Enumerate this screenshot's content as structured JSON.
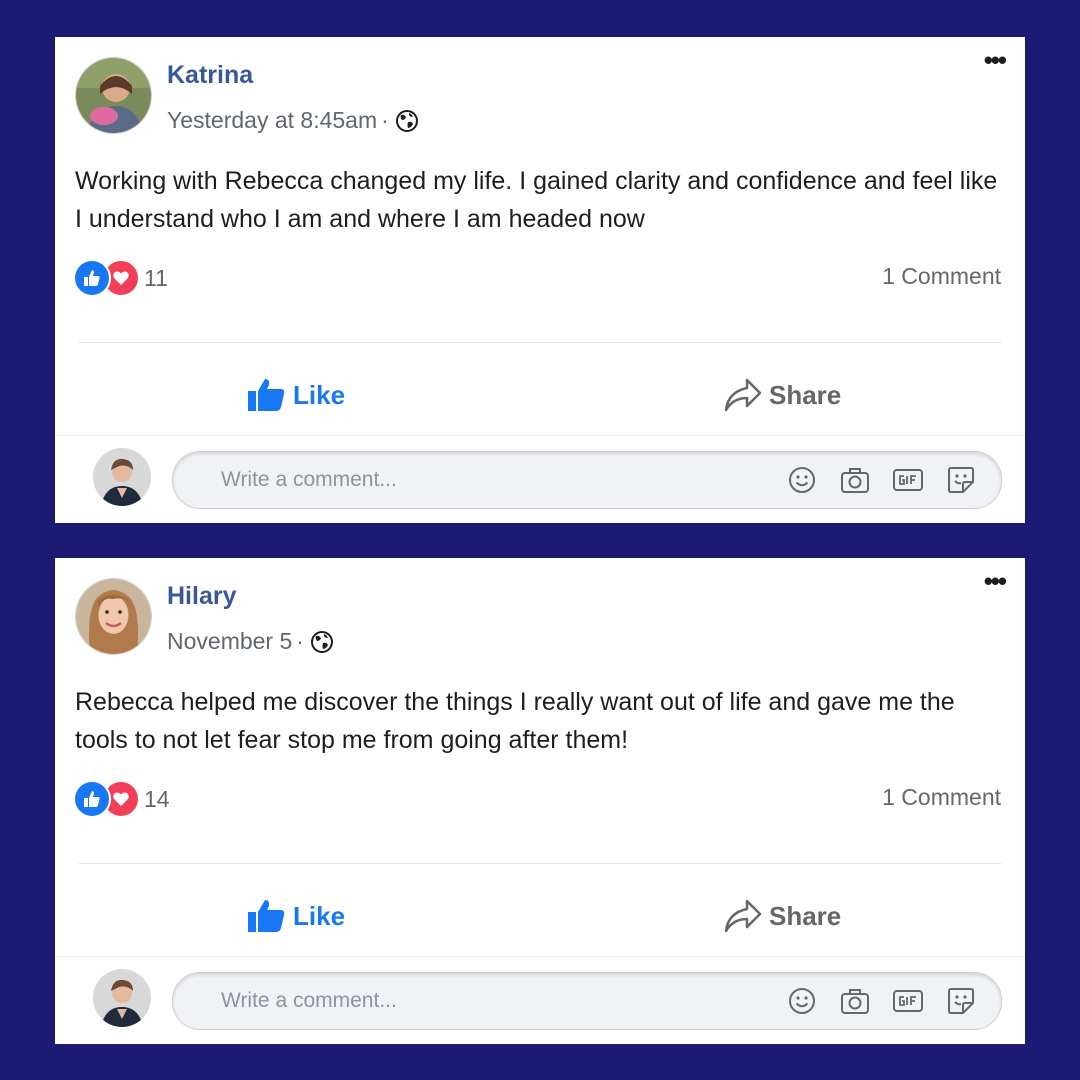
{
  "posts": [
    {
      "author": "Katrina",
      "timestamp": "Yesterday at 8:45am",
      "separator": "·",
      "privacy_icon": "globe-icon",
      "text": "Working with Rebecca changed my life. I gained clarity and confidence and feel like I understand who I am and where I am headed now",
      "reaction_count": "11",
      "comment_count": "1 Comment",
      "like_label": "Like",
      "share_label": "Share",
      "comment_placeholder": "Write a comment...",
      "more_label": "•••"
    },
    {
      "author": "Hilary",
      "timestamp": "November 5",
      "separator": "·",
      "privacy_icon": "globe-icon",
      "text": "Rebecca helped me discover the things I really want out of life and gave me the tools to not let fear stop me from going after them!",
      "reaction_count": "14",
      "comment_count": "1 Comment",
      "like_label": "Like",
      "share_label": "Share",
      "comment_placeholder": "Write a comment...",
      "more_label": "•••"
    }
  ],
  "colors": {
    "background": "#1c1a72",
    "name_link": "#385898",
    "like_blue": "#1877f2",
    "love_red": "#f33e58"
  },
  "icons": [
    "thumbs-up-icon",
    "heart-icon",
    "share-arrow-icon",
    "emoji-icon",
    "camera-icon",
    "gif-icon",
    "sticker-icon",
    "globe-icon",
    "more-options-icon"
  ]
}
